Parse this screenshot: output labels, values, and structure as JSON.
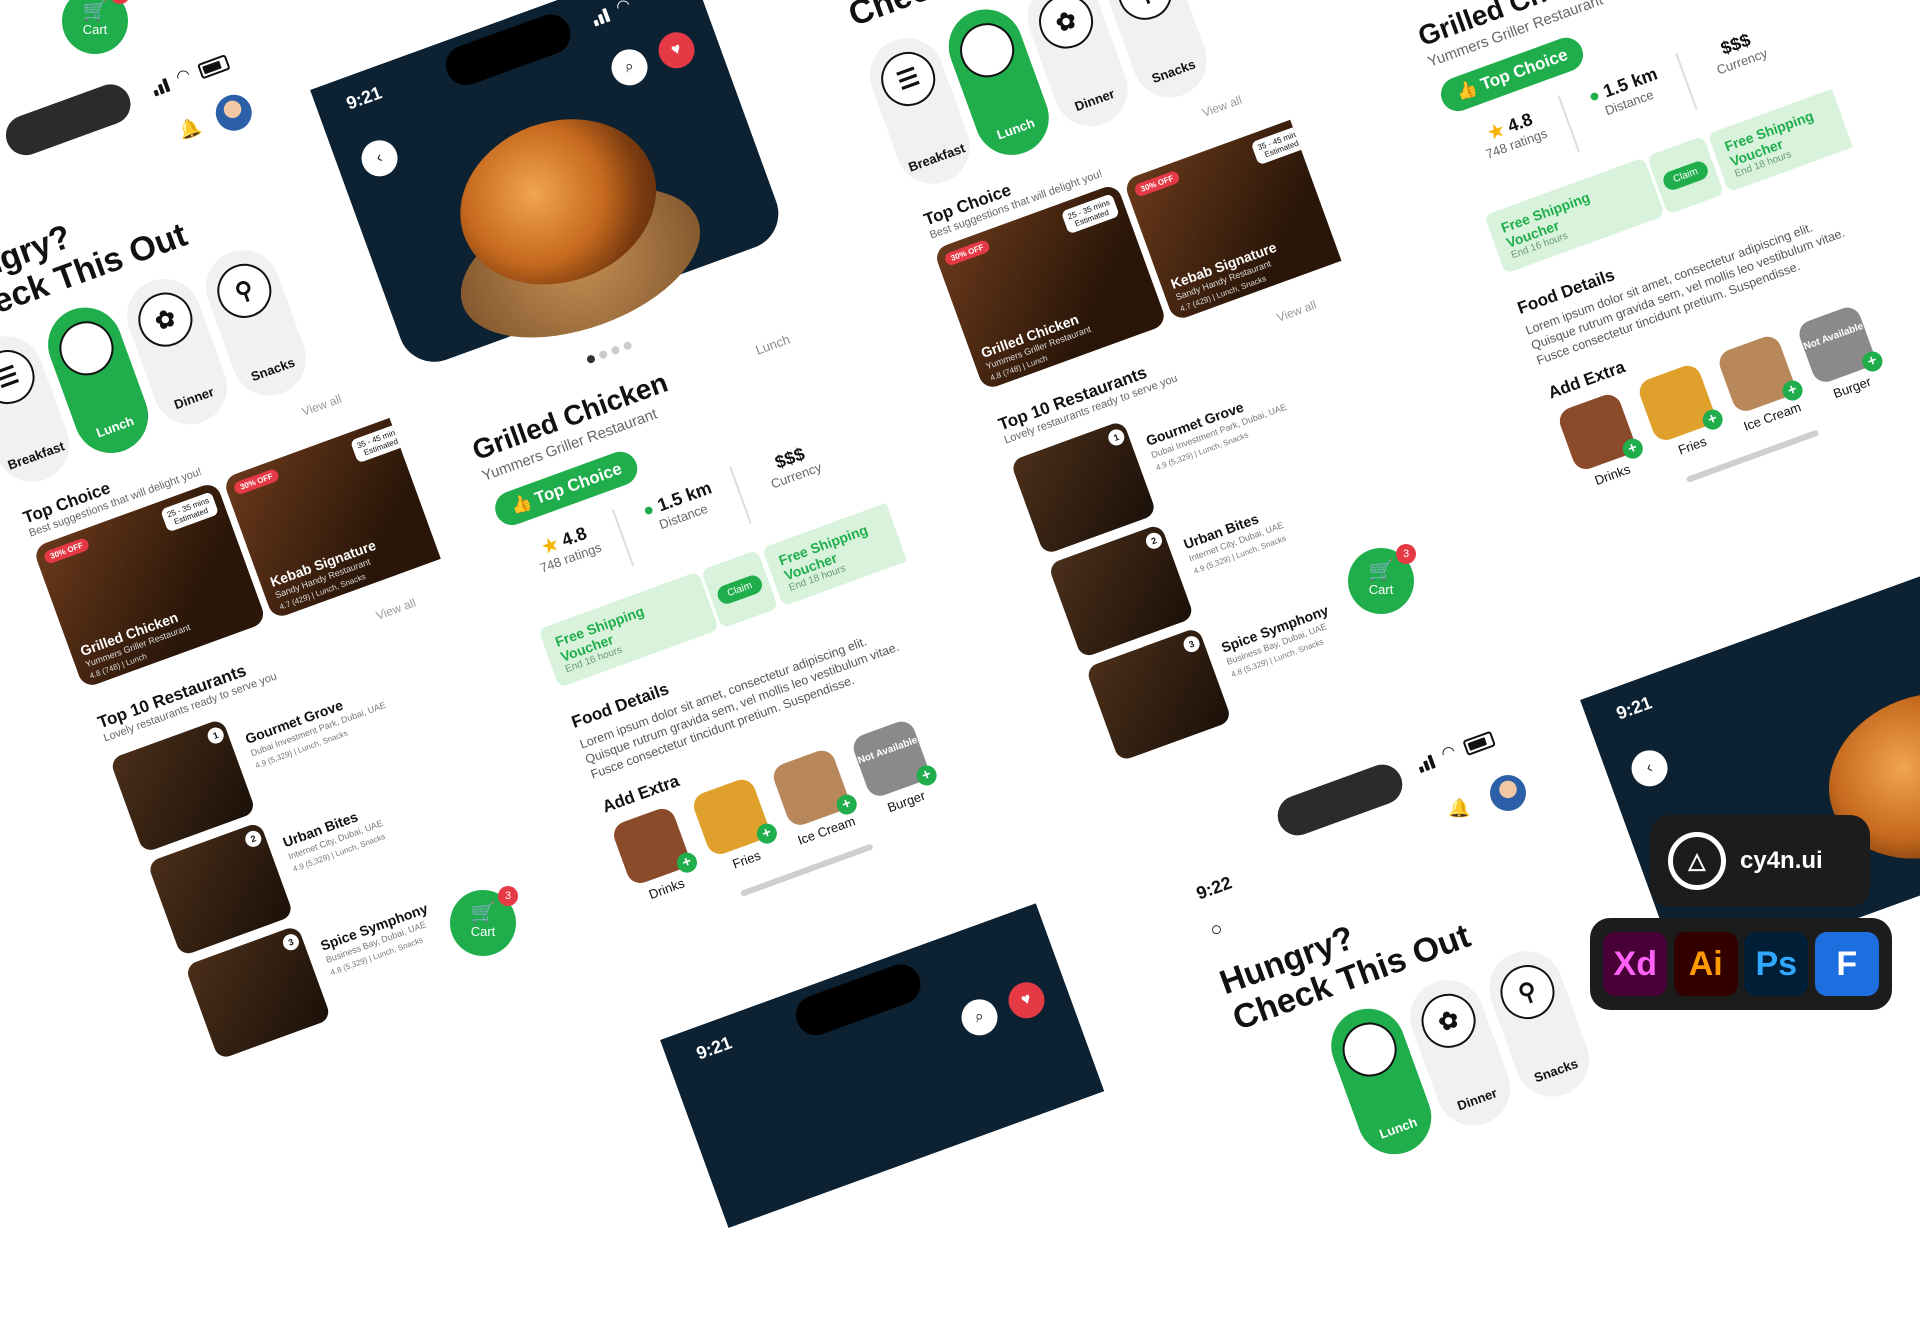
{
  "status": {
    "time_a": "9:21",
    "time_b": "9:22"
  },
  "detail": {
    "title": "Grilled Chicken",
    "restaurant": "Yummers Griller Restaurant",
    "meal_tag": "Lunch",
    "badge": "Top Choice",
    "rating": "4.8",
    "rating_label": "748 ratings",
    "distance": "1.5 km",
    "distance_label": "Distance",
    "price": "$$$",
    "price_label": "Currency",
    "voucher_title": "Free Shipping Voucher",
    "voucher_sub": "End 16 hours",
    "voucher2_sub": "End 18 hours",
    "claim": "Claim",
    "food_details_title": "Food Details",
    "food_details_text": "Lorem ipsum dolor sit amet, consectetur adipiscing elit. Quisque rutrum gravida sem, vel mollis leo vestibulum vitae. Fusce consectetur tincidunt pretium. Suspendisse.",
    "add_extra_title": "Add Extra",
    "extras": [
      {
        "label": "Drinks",
        "icon": "drink-icon"
      },
      {
        "label": "Fries",
        "icon": "fries-icon"
      },
      {
        "label": "Ice Cream",
        "icon": "ice-cream-icon"
      },
      {
        "label": "Burger",
        "icon": "burger-icon",
        "status": "Not Available"
      }
    ]
  },
  "home": {
    "headline_1": "Hungry?",
    "headline_2": "Check This Out",
    "categories": [
      {
        "label": "Breakfast",
        "icon": "pancake-icon"
      },
      {
        "label": "Lunch",
        "icon": "plate-icon"
      },
      {
        "label": "Dinner",
        "icon": "dinner-icon"
      },
      {
        "label": "Snacks",
        "icon": "snack-icon"
      }
    ],
    "view_all": "View all",
    "top_choice_title": "Top Choice",
    "top_choice_sub": "Best suggestions that will delight you!",
    "cards": [
      {
        "title": "Grilled Chicken",
        "sub": "Yummers Griller Restaurant",
        "discount": "30% OFF",
        "eta": "25 - 35 mins",
        "eta_label": "Estimated",
        "meta": "4.8 (748) | Lunch"
      },
      {
        "title": "Kebab Signature",
        "sub": "Sandy Handy Restaurant",
        "discount": "30% OFF",
        "eta": "35 - 45 mins",
        "eta_label": "Estimated",
        "meta": "4.7 (429) | Lunch, Snacks"
      }
    ],
    "top10_title": "Top 10 Restaurants",
    "top10_sub": "Lovely restaurants ready to serve you",
    "restaurants": [
      {
        "rank": "1",
        "name": "Gourmet Grove",
        "address": "Dubai Investment Park, Dubai, UAE",
        "meta": "4.9 (5,329) | Lunch, Snacks"
      },
      {
        "rank": "2",
        "name": "Urban Bites",
        "address": "Internet City, Dubai, UAE",
        "meta": "4.9 (5,329) | Lunch, Snacks"
      },
      {
        "rank": "3",
        "name": "Spice Symphony",
        "address": "Business Bay, Dubai, UAE",
        "meta": "4.8 (5,329) | Lunch, Snacks"
      }
    ],
    "cart_label": "Cart",
    "cart_count": "3"
  },
  "brand": {
    "name": "cy4n.ui",
    "logo_icon": "cy4n-logo-icon"
  },
  "tools": [
    "Xd",
    "Ai",
    "Ps",
    "F"
  ],
  "colors": {
    "accent": "#1fae4b",
    "dark": "#0c2233",
    "alert": "#e53945"
  }
}
